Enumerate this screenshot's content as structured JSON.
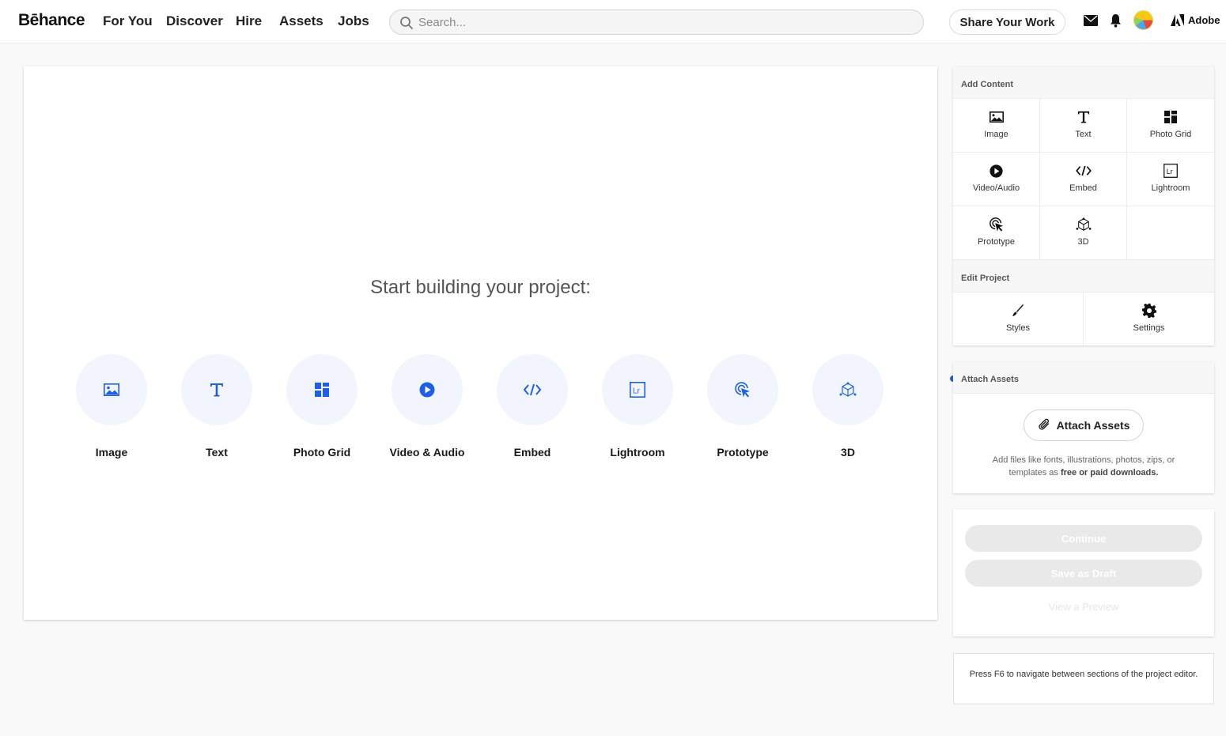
{
  "nav": {
    "logo": "Bēhance",
    "links": [
      "For You",
      "Discover",
      "Hire",
      "Assets",
      "Jobs"
    ],
    "search_placeholder": "Search...",
    "share_button": "Share Your Work",
    "adobe_label": "Adobe",
    "icons": [
      "mail-icon",
      "bell-icon",
      "avatar",
      "adobe-logo-icon"
    ]
  },
  "canvas": {
    "title": "Start building your project:",
    "tools": [
      {
        "label": "Image",
        "icon": "image-icon"
      },
      {
        "label": "Text",
        "icon": "text-icon"
      },
      {
        "label": "Photo Grid",
        "icon": "photo-grid-icon"
      },
      {
        "label": "Video & Audio",
        "icon": "play-icon"
      },
      {
        "label": "Embed",
        "icon": "code-icon"
      },
      {
        "label": "Lightroom",
        "icon": "lightroom-icon"
      },
      {
        "label": "Prototype",
        "icon": "cursor-click-icon"
      },
      {
        "label": "3D",
        "icon": "cube-icon"
      }
    ],
    "accent_color": "#1f5fe5"
  },
  "add_content": {
    "heading": "Add Content",
    "items": [
      {
        "label": "Image"
      },
      {
        "label": "Text"
      },
      {
        "label": "Photo Grid"
      },
      {
        "label": "Video/Audio"
      },
      {
        "label": "Embed"
      },
      {
        "label": "Lightroom"
      },
      {
        "label": "Prototype"
      },
      {
        "label": "3D"
      }
    ]
  },
  "edit_project": {
    "heading": "Edit Project",
    "items": [
      {
        "label": "Styles"
      },
      {
        "label": "Settings"
      }
    ]
  },
  "attach_assets": {
    "heading": "Attach Assets",
    "button": "Attach Assets",
    "description_prefix": "Add files like fonts, illustrations, photos, zips, or templates as ",
    "description_bold": "free or paid downloads."
  },
  "actions": {
    "continue": "Continue",
    "save_draft": "Save as Draft",
    "preview": "View a Preview"
  },
  "footer_note": "Press F6 to navigate between sections of the project editor."
}
